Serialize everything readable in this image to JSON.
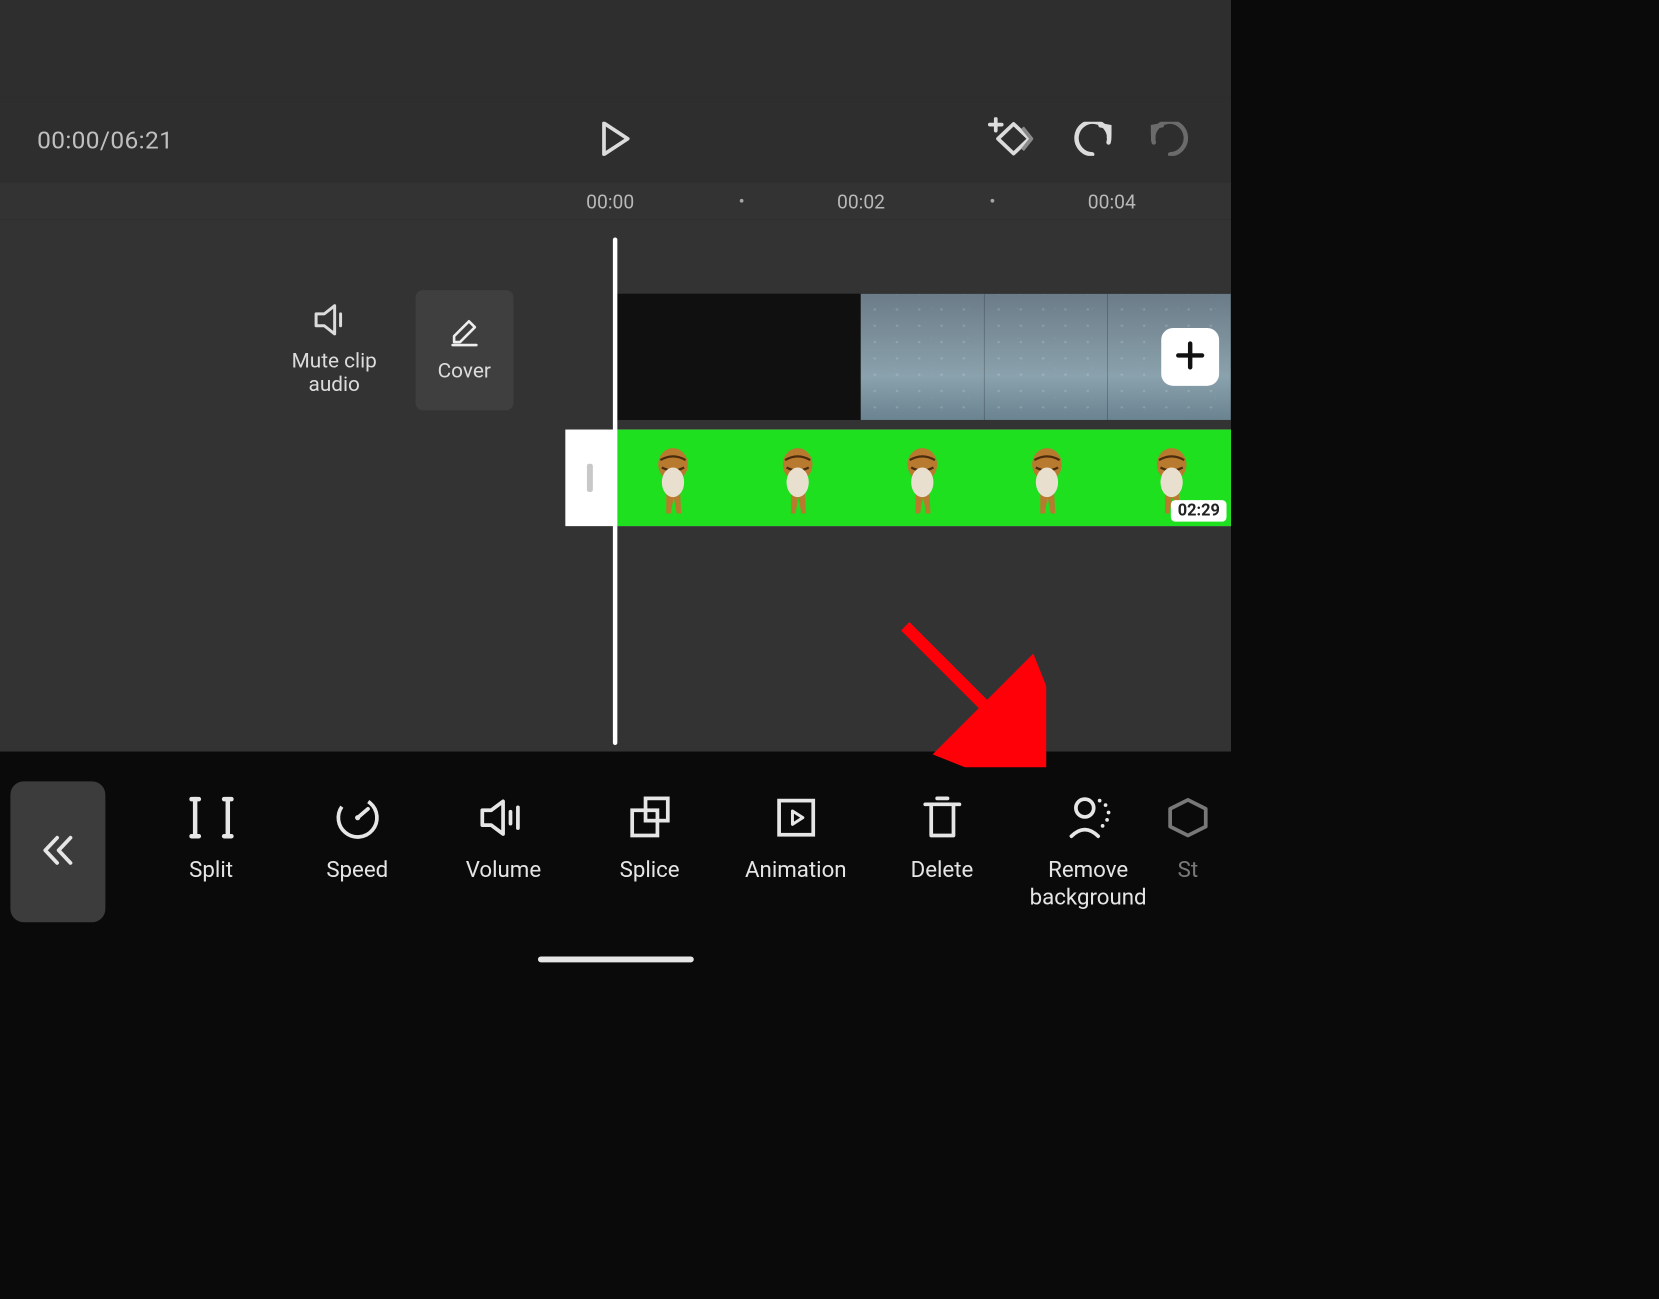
{
  "playbar": {
    "timecode": "00:00/06:21"
  },
  "ruler": {
    "ticks": [
      "00:00",
      "00:02",
      "00:04"
    ]
  },
  "leftTools": {
    "mute_label": "Mute clip\naudio",
    "cover_label": "Cover"
  },
  "overlay": {
    "duration": "02:29"
  },
  "toolbar": {
    "split": "Split",
    "speed": "Speed",
    "volume": "Volume",
    "splice": "Splice",
    "animation": "Animation",
    "delete": "Delete",
    "remove_bg": "Remove\nbackground",
    "partial": "St"
  }
}
